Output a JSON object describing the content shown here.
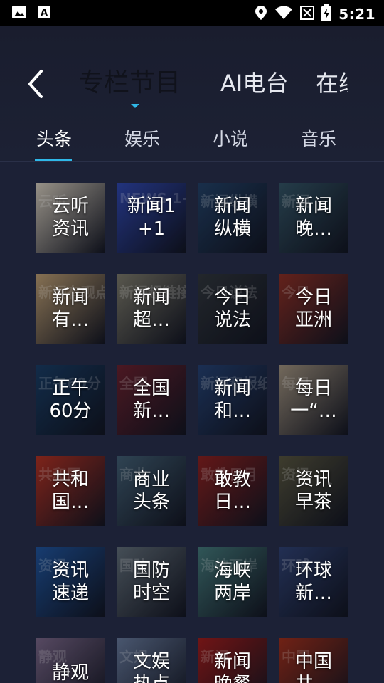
{
  "status_bar": {
    "time": "5:21",
    "icons_left": [
      "image-icon",
      "text-a-icon"
    ],
    "icons_right": [
      "location-icon",
      "wifi-icon",
      "no-signal-icon",
      "battery-charging-icon"
    ]
  },
  "header": {
    "back_icon": "chevron-left-icon",
    "tabs": [
      {
        "label": "专栏节目",
        "active": true
      },
      {
        "label": "AI电台",
        "active": false
      },
      {
        "label": "在线",
        "active": false
      }
    ]
  },
  "sub_tabs": [
    {
      "label": "头条",
      "active": true
    },
    {
      "label": "娱乐",
      "active": false
    },
    {
      "label": "小说",
      "active": false
    },
    {
      "label": "音乐",
      "active": false
    }
  ],
  "accent_color": "#2fb8e8",
  "programs": [
    {
      "label": "云听\n资讯",
      "color": "#b9b2a6",
      "deco": "云听"
    },
    {
      "label": "新闻1\n+1",
      "color": "#2a3f9a",
      "deco": "NEWS 1+1"
    },
    {
      "label": "新闻\n纵横",
      "color": "#1f3a5c",
      "deco": "新闻纵横"
    },
    {
      "label": "新闻\n晚…",
      "color": "#2d4a5a",
      "deco": "新闻"
    },
    {
      "label": "新闻\n有…",
      "color": "#a48a66",
      "deco": "新闻有观点"
    },
    {
      "label": "新闻\n超…",
      "color": "#6d6b5f",
      "deco": "新闻超链接"
    },
    {
      "label": "今日\n说法",
      "color": "#2b3036",
      "deco": "今日说法"
    },
    {
      "label": "今日\n亚洲",
      "color": "#7a2a22",
      "deco": "今日"
    },
    {
      "label": "正午\n60分",
      "color": "#16365a",
      "deco": "正午60分"
    },
    {
      "label": "全国\n新…",
      "color": "#5c1e2a",
      "deco": "全国"
    },
    {
      "label": "新闻\n和…",
      "color": "#213a66",
      "deco": "新闻和报纸"
    },
    {
      "label": "每日\n一“…",
      "color": "#8c8070",
      "deco": "每日"
    },
    {
      "label": "共和\n国…",
      "color": "#9a2c20",
      "deco": "共和国"
    },
    {
      "label": "商业\n头条",
      "color": "#3a5366",
      "deco": "商业"
    },
    {
      "label": "敢教\n日…",
      "color": "#7a1e1e",
      "deco": "敢教日月"
    },
    {
      "label": "资讯\n早茶",
      "color": "#4c4a38",
      "deco": "资讯"
    },
    {
      "label": "资讯\n速递",
      "color": "#1c4a8a",
      "deco": "资讯"
    },
    {
      "label": "国防\n时空",
      "color": "#55606a",
      "deco": "国防"
    },
    {
      "label": "海峡\n两岸",
      "color": "#3c6a6c",
      "deco": "海峡两岸"
    },
    {
      "label": "环球\n新…",
      "color": "#2a3a66",
      "deco": "环球"
    },
    {
      "label": "静观",
      "color": "#6a5a78",
      "deco": "静观"
    },
    {
      "label": "文娱\n热点",
      "color": "#5a6a88",
      "deco": "文娱"
    },
    {
      "label": "新闻\n晚餐",
      "color": "#8a1a1a",
      "deco": "新闻"
    },
    {
      "label": "中国\n共…",
      "color": "#8a2a1a",
      "deco": "中国"
    }
  ]
}
